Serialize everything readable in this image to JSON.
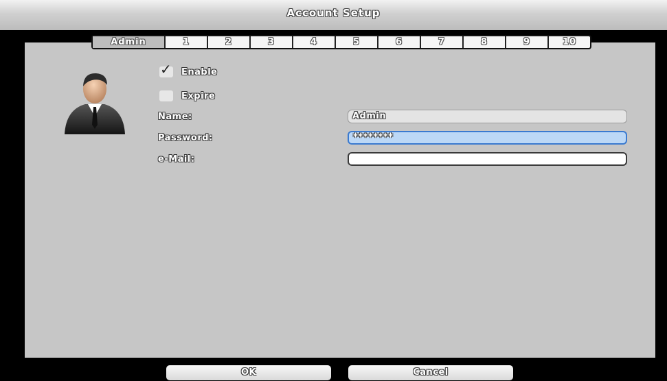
{
  "window": {
    "title": "Account Setup"
  },
  "tabs": [
    "Admin",
    "1",
    "2",
    "3",
    "4",
    "5",
    "6",
    "7",
    "8",
    "9",
    "10"
  ],
  "active_tab": "Admin",
  "account": {
    "enable_label": "Enable",
    "enable_checked": true,
    "expire_label": "Expire",
    "expire_checked": false,
    "name_label": "Name:",
    "name_value": "Admin",
    "password_label": "Password:",
    "password_value": "********",
    "email_label": "e-Mail:",
    "email_value": ""
  },
  "buttons": {
    "ok": "OK",
    "cancel": "Cancel"
  },
  "icons": {
    "user": "user-avatar-icon",
    "check": "checkmark-icon"
  },
  "colors": {
    "panel": "#c6c6c6",
    "focus_border": "#3a7ad0",
    "focus_fill": "#bcd8f6"
  }
}
